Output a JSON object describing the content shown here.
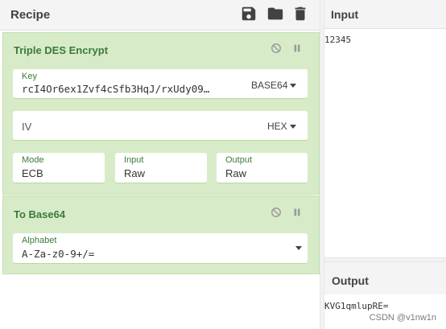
{
  "recipe": {
    "title": "Recipe",
    "icons": [
      "save-icon",
      "folder-icon",
      "trash-icon"
    ],
    "operations": [
      {
        "name": "Triple DES Encrypt",
        "key": {
          "label": "Key",
          "value": "rcI4Or6ex1Zvf4cSfb3HqJ/rxUdy09…",
          "format": "BASE64"
        },
        "iv": {
          "label": "IV",
          "value": "",
          "format": "HEX"
        },
        "mode": {
          "label": "Mode",
          "value": "ECB"
        },
        "input": {
          "label": "Input",
          "value": "Raw"
        },
        "output": {
          "label": "Output",
          "value": "Raw"
        }
      },
      {
        "name": "To Base64",
        "alphabet": {
          "label": "Alphabet",
          "value": "A-Za-z0-9+/="
        }
      }
    ]
  },
  "input": {
    "title": "Input",
    "text": "12345"
  },
  "output": {
    "title": "Output",
    "text": "KVG1qmlupRE="
  },
  "watermark": "CSDN @v1nw1n",
  "colors": {
    "operation_bg": "#d7ebc8",
    "operation_title": "#3c7a3a",
    "header_bg": "#f4f4f4"
  }
}
